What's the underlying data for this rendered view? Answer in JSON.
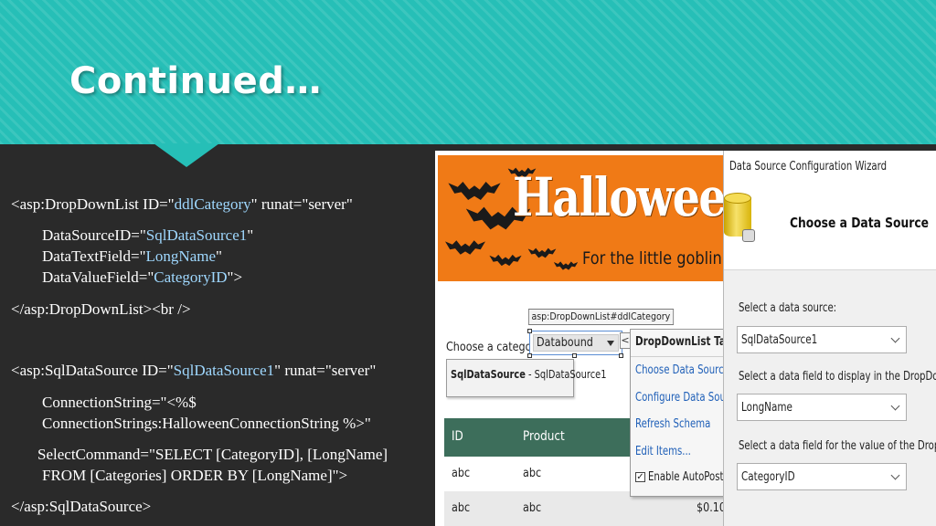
{
  "slide": {
    "title": "Continued…"
  },
  "code": {
    "l1_a": "<asp:DropDownList ID=\"",
    "l1_v": "ddlCategory",
    "l1_b": "\" runat=\"server\"",
    "l2_a": "DataSourceID=\"",
    "l2_v": "SqlDataSource1",
    "l2_b": "\"",
    "l3_a": "DataTextField=\"",
    "l3_v": "LongName",
    "l3_b": "\"",
    "l4_a": "DataValueField=\"",
    "l4_v": "CategoryID",
    "l4_b": "\">",
    "l5": "</asp:DropDownList><br />",
    "l6_a": "<asp:SqlDataSource ID=\"",
    "l6_v": "SqlDataSource1",
    "l6_b": "\" runat=\"server\"",
    "l7": "ConnectionString=\"<%$",
    "l8": "ConnectionStrings:HalloweenConnectionString %>\"",
    "l9": "SelectCommand=\"SELECT [CategoryID], [LongName]",
    "l10": "FROM [Categories]  ORDER BY [LongName]\">",
    "l11": "</asp:SqlDataSource>"
  },
  "designer": {
    "banner_title": "Halloween Su",
    "banner_subtitle": "For the little goblin in",
    "ddl_tag": "asp:DropDownList#ddlCategory",
    "choose_label": "Choose a category:",
    "ddl_value": "Databound",
    "ds_bold": "SqlDataSource",
    "ds_rest": " - SqlDataSource1",
    "grid": {
      "headers": [
        "ID",
        "Product"
      ],
      "rows": [
        [
          "abc",
          "abc",
          ""
        ],
        [
          "abc",
          "abc",
          "$0.10"
        ]
      ]
    },
    "smart_tag": "<",
    "tasks": {
      "title": "DropDownList Tasks",
      "links": [
        "Choose Data Source...",
        "Configure Data Source...",
        "Refresh Schema",
        "Edit Items..."
      ],
      "checkbox_label": "Enable AutoPostBack",
      "checkbox_mark": "✓"
    }
  },
  "wizard": {
    "window_title": "Data Source Configuration Wizard",
    "heading": "Choose a Data Source",
    "source_label": "Select a data source:",
    "source_value": "SqlDataSource1",
    "display_label": "Select a data field to display in the DropDownList:",
    "display_value": "LongName",
    "value_label": "Select a data field for the value of the DropDownList:",
    "value_value": "CategoryID"
  }
}
